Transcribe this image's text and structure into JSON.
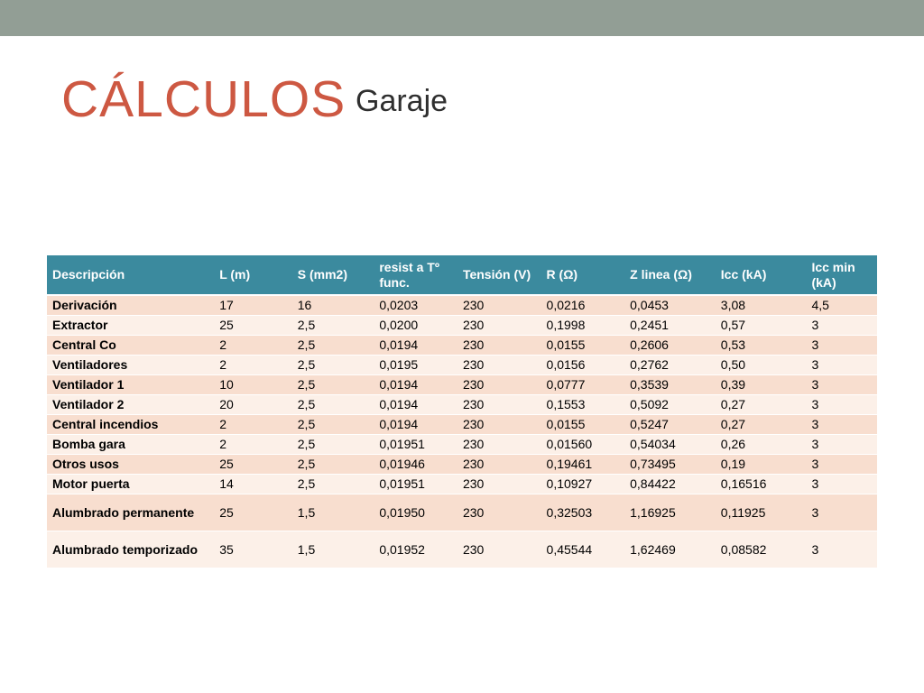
{
  "slide": {
    "title": "CÁLCULOS",
    "subtitle": "Garaje"
  },
  "table": {
    "headers": [
      "Descripción",
      "L (m)",
      "S (mm2)",
      "resist a Tº func.",
      "Tensión (V)",
      "R (Ω)",
      "Z linea (Ω)",
      "Icc (kA)",
      "Icc min (kA)"
    ],
    "rows": [
      [
        "Derivación",
        "17",
        "16",
        "0,0203",
        "230",
        "0,0216",
        "0,0453",
        "3,08",
        "4,5"
      ],
      [
        "Extractor",
        "25",
        "2,5",
        "0,0200",
        "230",
        "0,1998",
        "0,2451",
        "0,57",
        "3"
      ],
      [
        "Central Co",
        "2",
        "2,5",
        "0,0194",
        "230",
        "0,0155",
        "0,2606",
        "0,53",
        "3"
      ],
      [
        "Ventiladores",
        "2",
        "2,5",
        "0,0195",
        "230",
        "0,0156",
        "0,2762",
        "0,50",
        "3"
      ],
      [
        "Ventilador 1",
        "10",
        "2,5",
        "0,0194",
        "230",
        "0,0777",
        "0,3539",
        "0,39",
        "3"
      ],
      [
        "Ventilador 2",
        "20",
        "2,5",
        "0,0194",
        "230",
        "0,1553",
        "0,5092",
        "0,27",
        "3"
      ],
      [
        "Central incendios",
        "2",
        "2,5",
        "0,0194",
        "230",
        "0,0155",
        "0,5247",
        "0,27",
        "3"
      ],
      [
        "Bomba gara",
        "2",
        "2,5",
        "0,01951",
        "230",
        "0,01560",
        "0,54034",
        "0,26",
        "3"
      ],
      [
        "Otros usos",
        "25",
        "2,5",
        "0,01946",
        "230",
        "0,19461",
        "0,73495",
        "0,19",
        "3"
      ],
      [
        "Motor puerta",
        "14",
        "2,5",
        "0,01951",
        "230",
        "0,10927",
        "0,84422",
        "0,16516",
        "3"
      ],
      [
        "Alumbrado permanente",
        "25",
        "1,5",
        "0,01950",
        "230",
        "0,32503",
        "1,16925",
        "0,11925",
        "3"
      ],
      [
        "Alumbrado temporizado",
        "35",
        "1,5",
        "0,01952",
        "230",
        "0,45544",
        "1,62469",
        "0,08582",
        "3"
      ]
    ]
  },
  "colors": {
    "top_bar": "#929e95",
    "title": "#cd5842",
    "header_bg": "#3b8a9e",
    "row_odd": "#f8decf",
    "row_even": "#fcf0e8"
  }
}
